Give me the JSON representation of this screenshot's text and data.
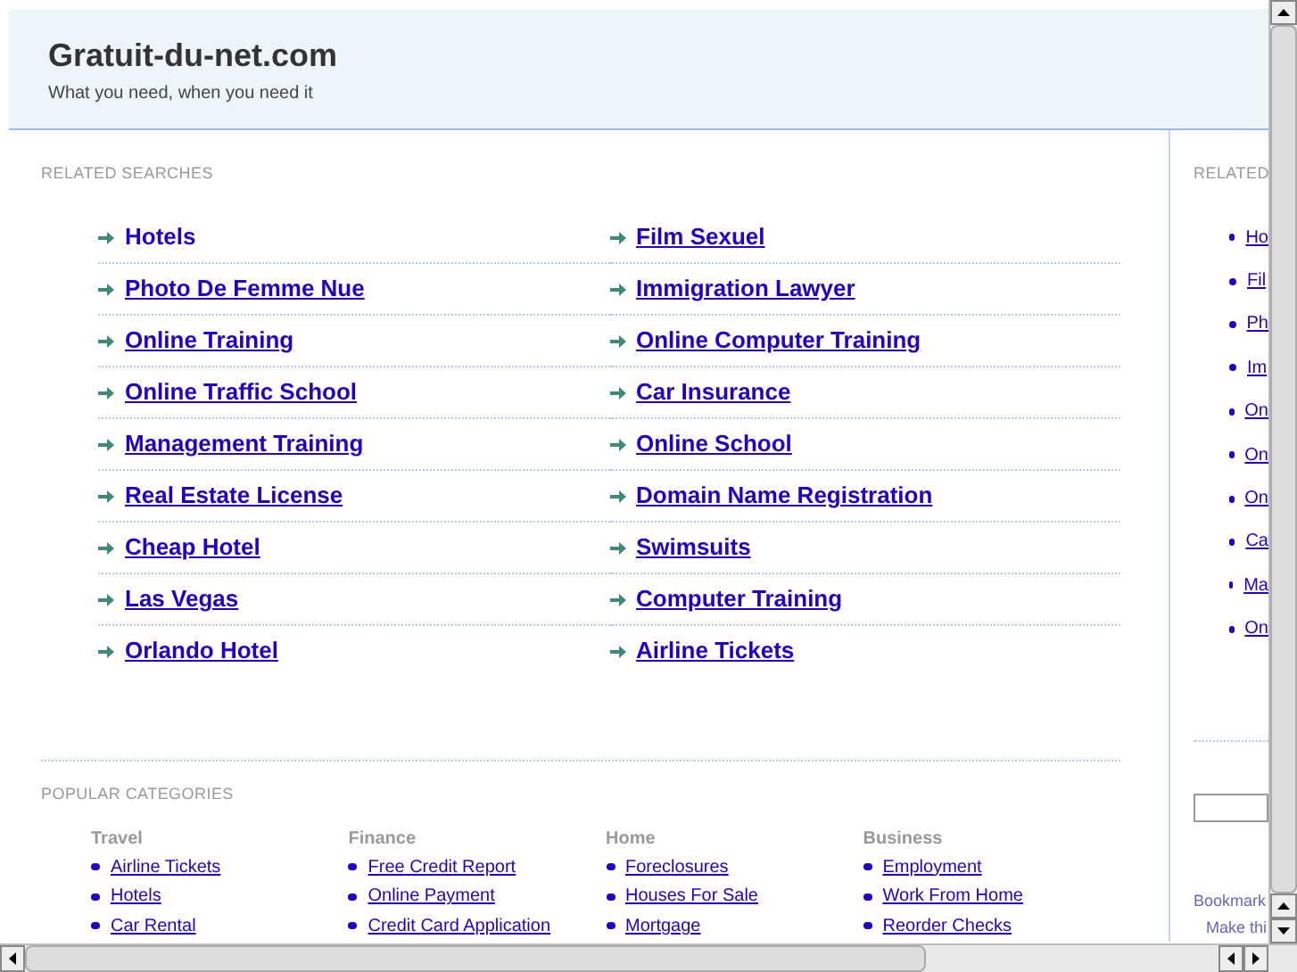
{
  "header": {
    "title": "Gratuit-du-net.com",
    "tagline": "What you need, when you need it"
  },
  "related_searches": {
    "heading": "RELATED SEARCHES",
    "links": [
      {
        "label": "Hotels",
        "hovered": true
      },
      {
        "label": "Film Sexuel",
        "hovered": false
      },
      {
        "label": "Photo De Femme Nue",
        "hovered": false
      },
      {
        "label": "Immigration Lawyer",
        "hovered": false
      },
      {
        "label": "Online Training",
        "hovered": false
      },
      {
        "label": "Online Computer Training",
        "hovered": false
      },
      {
        "label": "Online Traffic School",
        "hovered": false
      },
      {
        "label": "Car Insurance",
        "hovered": false
      },
      {
        "label": "Management Training",
        "hovered": false
      },
      {
        "label": "Online School",
        "hovered": false
      },
      {
        "label": "Real Estate License",
        "hovered": false
      },
      {
        "label": "Domain Name Registration",
        "hovered": false
      },
      {
        "label": "Cheap Hotel",
        "hovered": false
      },
      {
        "label": "Swimsuits",
        "hovered": false
      },
      {
        "label": "Las Vegas",
        "hovered": false
      },
      {
        "label": "Computer Training",
        "hovered": false
      },
      {
        "label": "Orlando Hotel",
        "hovered": false
      },
      {
        "label": "Airline Tickets",
        "hovered": false
      }
    ]
  },
  "popular_categories": {
    "heading": "POPULAR CATEGORIES",
    "groups": [
      {
        "title": "Travel",
        "links": [
          "Airline Tickets",
          "Hotels",
          "Car Rental"
        ]
      },
      {
        "title": "Finance",
        "links": [
          "Free Credit Report",
          "Online Payment",
          "Credit Card Application"
        ]
      },
      {
        "title": "Home",
        "links": [
          "Foreclosures",
          "Houses For Sale",
          "Mortgage"
        ]
      },
      {
        "title": "Business",
        "links": [
          "Employment",
          "Work From Home",
          "Reorder Checks"
        ]
      }
    ]
  },
  "sidebar": {
    "heading": "RELATED",
    "links": [
      "Ho",
      "Fil",
      "Ph",
      "Im",
      "On",
      "On",
      "On",
      "Ca",
      "Ma",
      "On"
    ],
    "bookmark": "Bookmark",
    "make": "Make thi"
  }
}
